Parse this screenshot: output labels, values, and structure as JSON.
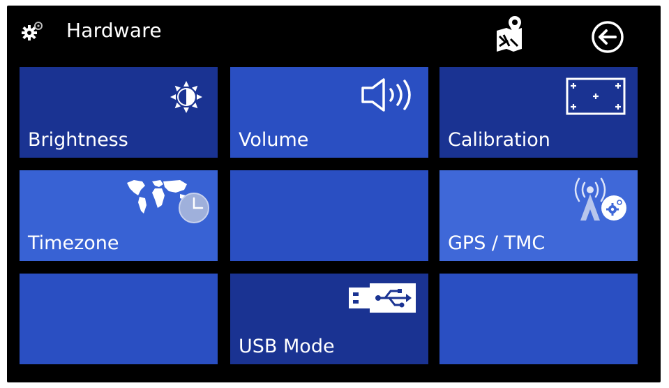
{
  "header": {
    "title": "Hardware",
    "icon": "gear-icon",
    "map_icon": "map-pin-icon",
    "back_icon": "back-arrow-icon"
  },
  "tiles": [
    {
      "label": "Brightness",
      "icon": "brightness-icon",
      "color": "#1a3392"
    },
    {
      "label": "Volume",
      "icon": "speaker-icon",
      "color": "#2a4fc2"
    },
    {
      "label": "Calibration",
      "icon": "calibration-icon",
      "color": "#1a3392"
    },
    {
      "label": "Timezone",
      "icon": "world-clock-icon",
      "color": "#3862d4"
    },
    {
      "label": "",
      "icon": "",
      "color": "#2a4fc2"
    },
    {
      "label": "GPS / TMC",
      "icon": "gps-antenna-icon",
      "color": "#3f68d8"
    },
    {
      "label": "",
      "icon": "",
      "color": "#2a4fc2"
    },
    {
      "label": "USB Mode",
      "icon": "usb-icon",
      "color": "#1a3392"
    },
    {
      "label": "",
      "icon": "",
      "color": "#2a4fc2"
    }
  ],
  "colors": {
    "background": "#000000",
    "text": "#ffffff",
    "tile_dark": "#1a3392",
    "tile_mid": "#2a4fc2",
    "tile_light": "#3a63d6"
  }
}
